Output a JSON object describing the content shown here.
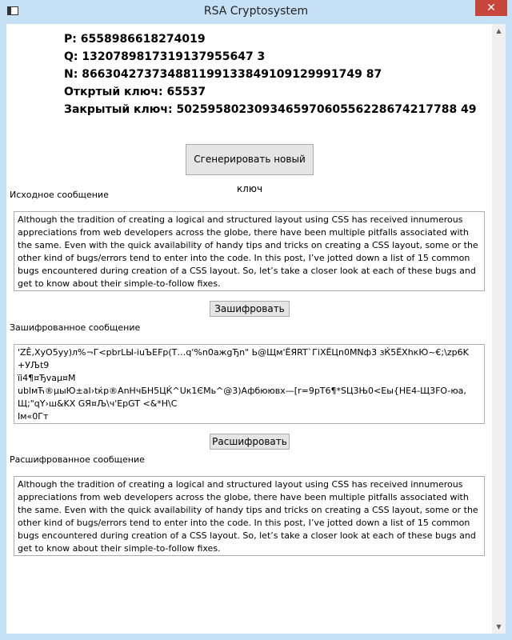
{
  "window": {
    "title": "RSA Cryptosystem",
    "close_label": "✕"
  },
  "keys": {
    "p_label": "P:",
    "p_value": "6558986618274019",
    "q_label": "Q:",
    "q_value": "1320789817319137955647 3",
    "n_label": "N:",
    "n_value": "866304273734881199133849109129991749 87",
    "public_label": "Откртый ключ:",
    "public_value": "65537",
    "private_label": "Закрытый ключ:",
    "private_value": "502595802309346597060556228674217788 49"
  },
  "buttons": {
    "generate": "Сгенерировать новый ключ",
    "encrypt": "Зашифровать",
    "decrypt": "Расшифровать"
  },
  "source": {
    "label": "Исходное сообщение",
    "text": "Although the tradition of creating a logical and structured layout using CSS has received innumerous appreciations from web developers across the globe, there have been multiple pitfalls associated with the same. Even with the quick availability of handy tips and tricks on creating a CSS layout, some or the other kind of bugs/errors tend to enter into the code. In this post, I’ve jotted down a list of 15 common bugs encountered during creation of a CSS layout. So, let’s take a closer look at each of these bugs and get to know about their simple-to-follow fixes."
  },
  "encrypted": {
    "label": "Зашифрованное сообщение",
    "lines": [
      "'ZÊ,XyO5yy)л%¬Г<pbrLЫ-iuЪEFp(T…q'%n0ажgЂn\" Ь@Щм'ЁЯRT`ГiXЁЦn0MNф3 зЌ5ЁXhкЮ~€;\\zp6K",
      "+УЉt9",
      "ïi4¶¤Ђvaµ¤M",
      "ublмЋ®µыЮ±aІ›tќp®AnHчБH5ЦЌ^Uк1ЄМь^@3)Афбюювх—[r=9pT6¶*SЦ3Њ0<Еы{HE4-Щ3FO-юа,",
      "Щ;\"qY›ш&KX GЯ¤Љ\\ч'EpGT          <&*H\\C",
      "Iм«0Гт"
    ]
  },
  "decrypted": {
    "label": "Расшифрованное сообщение",
    "text": "Although the tradition of creating a logical and structured layout using CSS has received innumerous appreciations from web developers across the globe, there have been multiple pitfalls associated with the same. Even with the quick availability of handy tips and tricks on creating a CSS layout, some or the other kind of bugs/errors tend to enter into the code. In this post, I’ve jotted down a list of 15 common bugs encountered during creation of a CSS layout. So, let’s take a closer look at each of these bugs and get to know about their simple-to-follow fixes."
  },
  "scrollbar": {
    "up_icon": "▲",
    "down_icon": "▼"
  }
}
